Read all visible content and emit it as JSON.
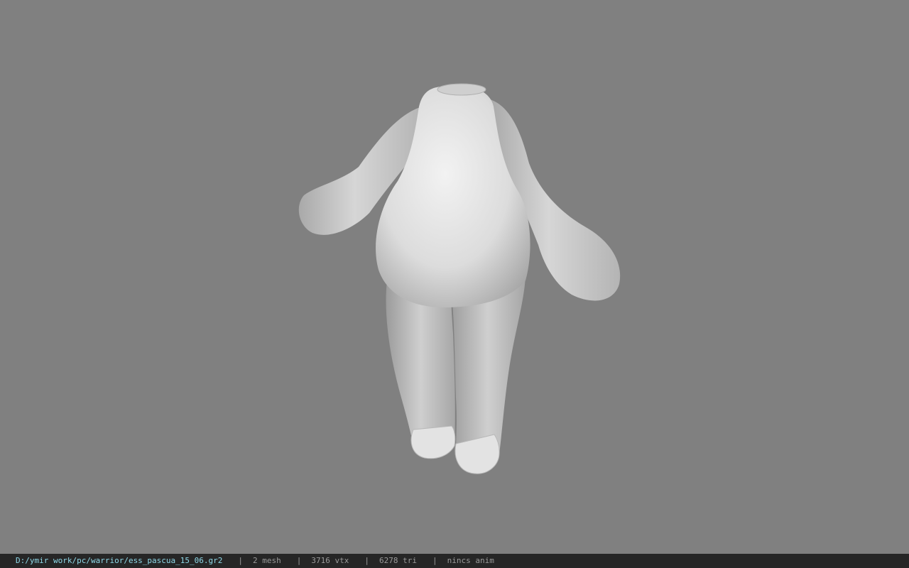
{
  "viewport": {
    "background": "#808080",
    "model": "headless-bunny-body-mesh"
  },
  "statusbar": {
    "path": "D:/ymir work/pc/warrior/ess_pascua_15_06.gr2",
    "separator": "|",
    "mesh": "2 mesh",
    "vtx": "3716 vtx",
    "tri": "6278 tri",
    "anim": "nincs anim",
    "path_color": "#8fd8e8"
  }
}
